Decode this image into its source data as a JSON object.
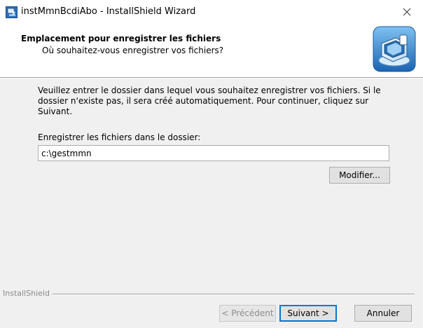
{
  "window": {
    "title": "instMmnBcdiAbo - InstallShield Wizard",
    "close_glyph": "✕"
  },
  "header": {
    "title": "Emplacement pour enregistrer les fichiers",
    "subtitle": "Où souhaitez-vous enregistrer vos fichiers?",
    "logo_icon": "installer-computer-icon"
  },
  "content": {
    "description": "Veuillez entrer le dossier dans lequel vous souhaitez enregistrer vos fichiers. Si le dossier n'existe pas, il sera créé automatiquement. Pour continuer, cliquez sur Suivant.",
    "field_label": "Enregistrer les fichiers dans le dossier:",
    "path_value": "c:\\gestmmn",
    "modify_label": "Modifier..."
  },
  "footer": {
    "brand": "InstallShield",
    "back_label": "< Précédent",
    "next_label": "Suivant >",
    "cancel_label": "Annuler"
  },
  "colors": {
    "accent": "#0078d7",
    "background": "#f0f0f0"
  }
}
